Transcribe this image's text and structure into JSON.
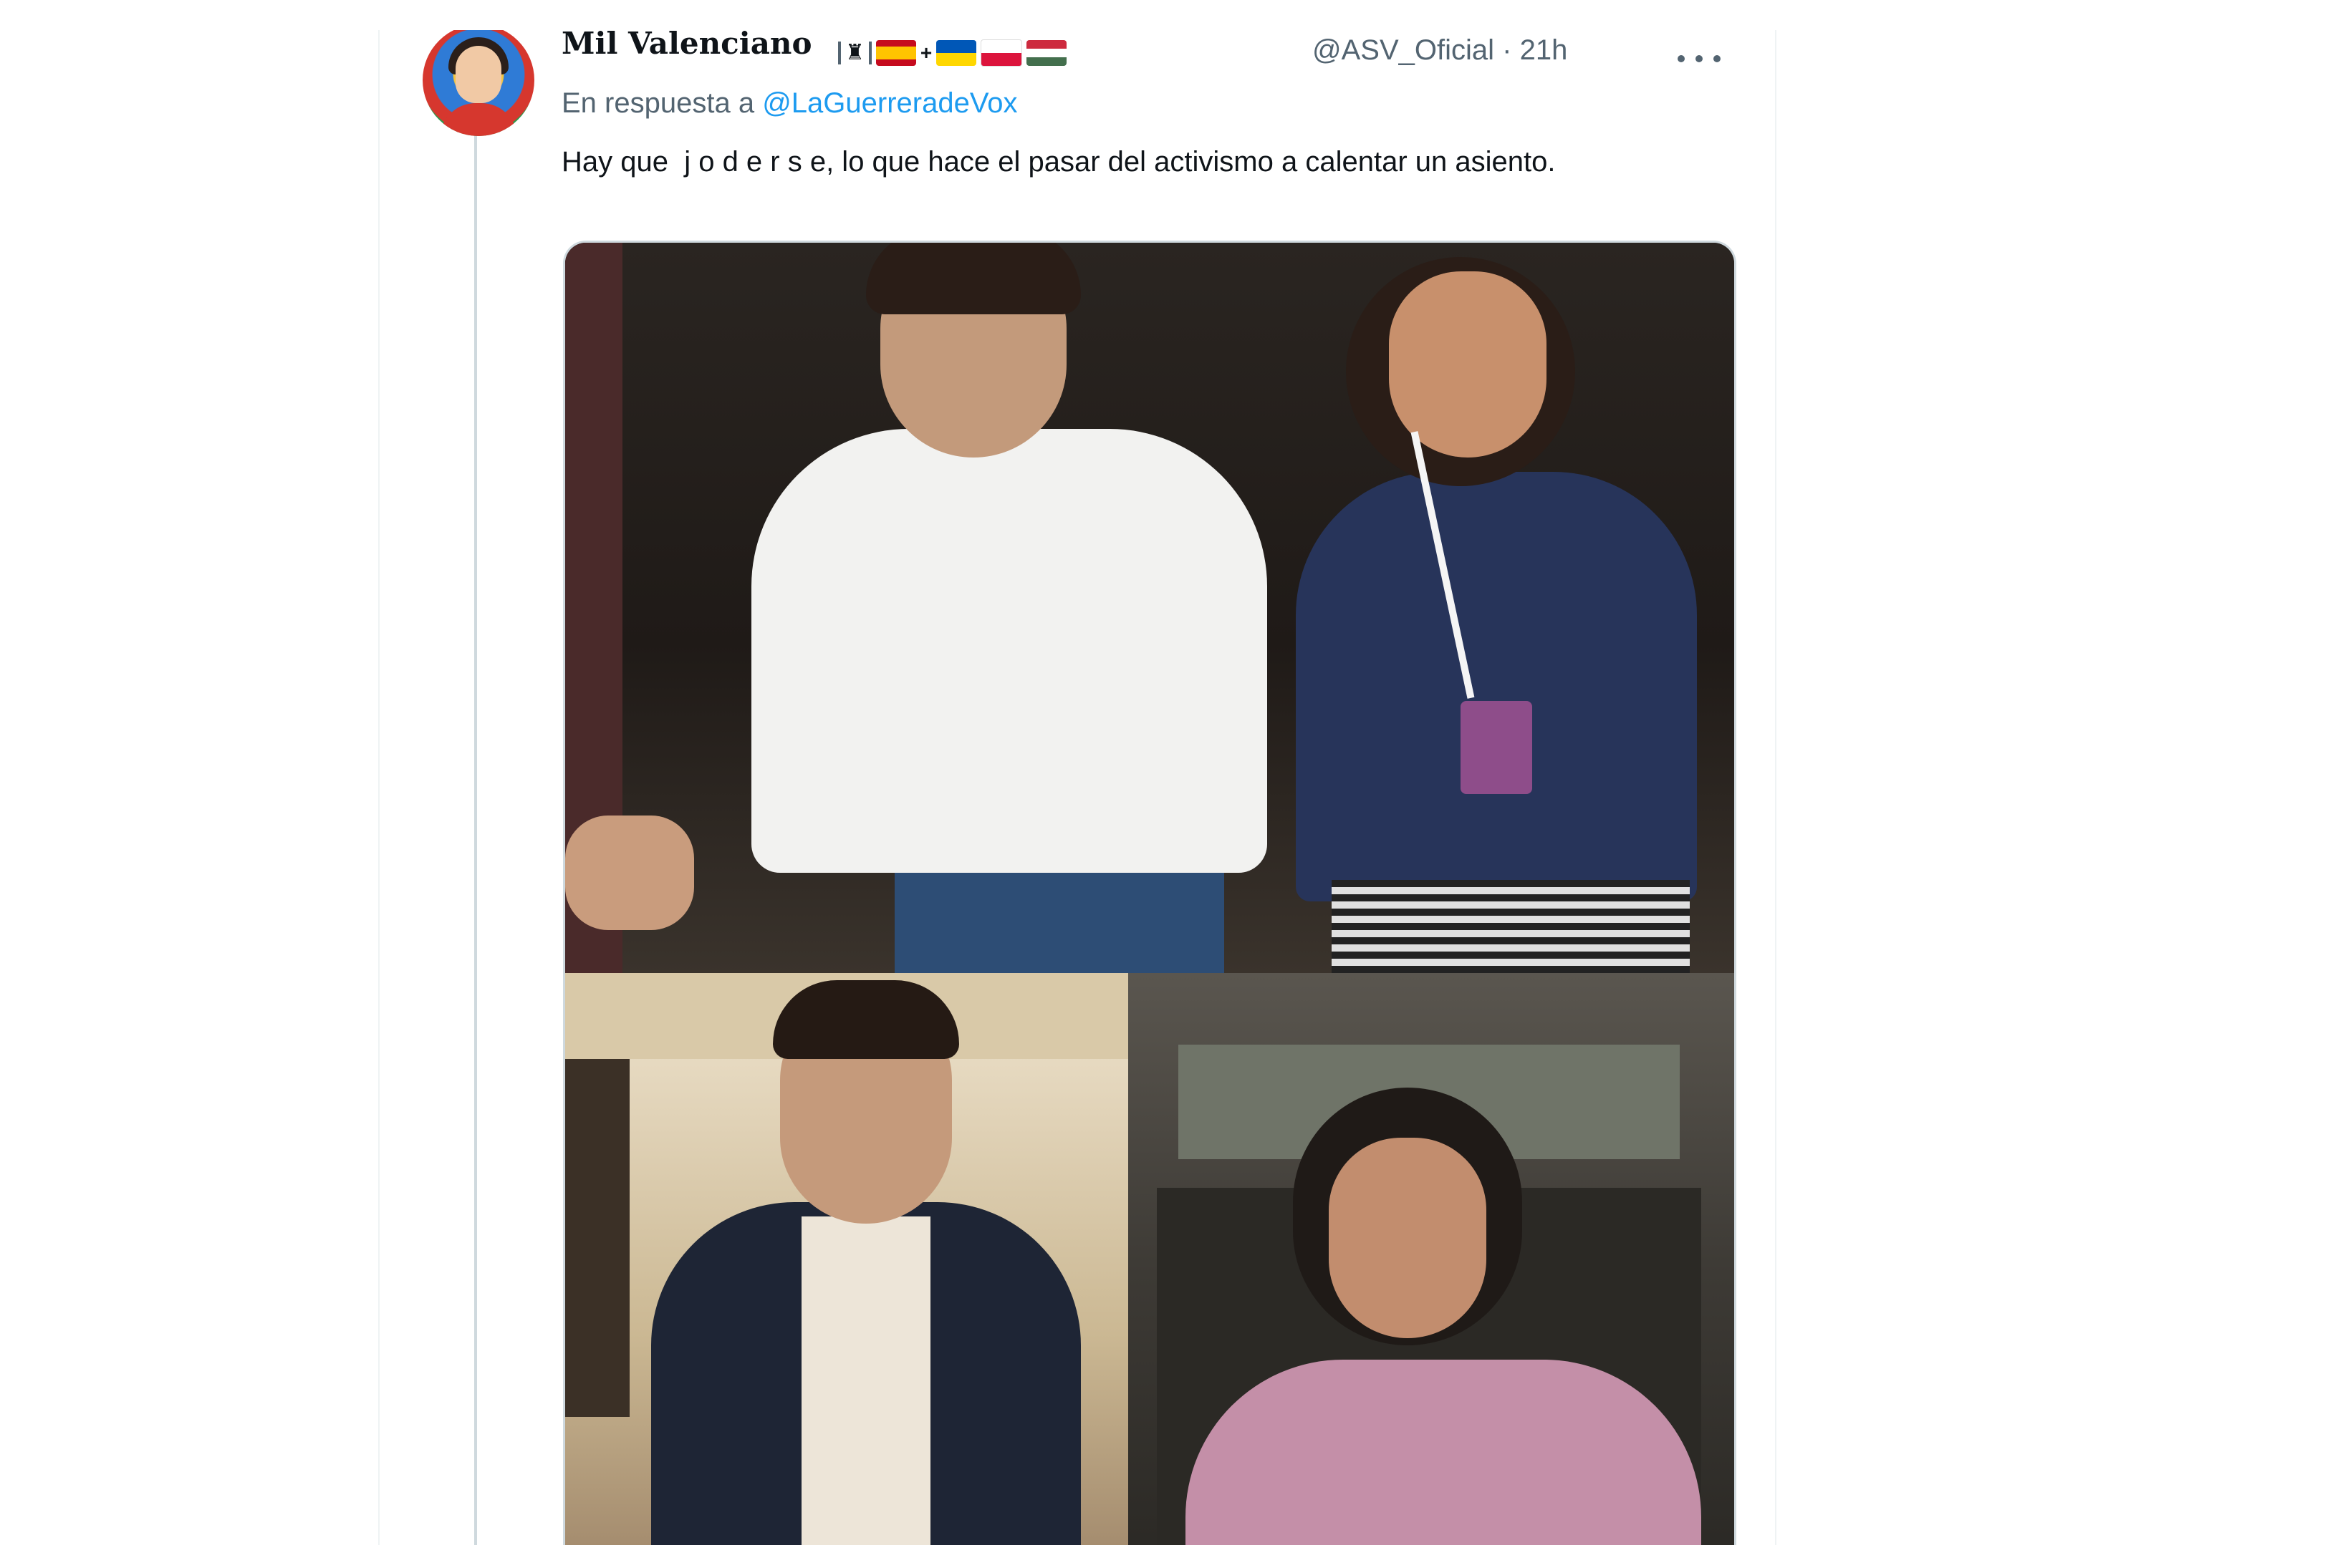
{
  "tweet": {
    "display_name": "Mil Valenciano",
    "handle_time": "@ASV_Oficial · 21h",
    "reply_prefix": "En respuesta a",
    "reply_mention": "@LaGuerreradeVox",
    "text": "Hay que  j o d e r s e, lo que hace el pasar del activismo a calentar un asiento.",
    "badge_icons": [
      "castle-icon",
      "flag-spain-icon",
      "flag-ukraine-icon",
      "flag-poland-icon",
      "flag-hungary-icon"
    ]
  },
  "colors": {
    "text": "#0f1419",
    "secondary": "#536471",
    "link": "#1d9bf0",
    "border": "#cfd9de"
  }
}
